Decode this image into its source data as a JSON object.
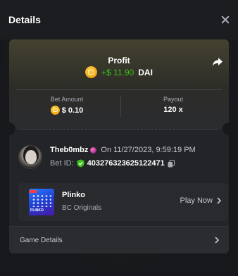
{
  "header": {
    "title": "Details"
  },
  "profit": {
    "label": "Profit",
    "amount": "+$ 11.90",
    "currency": "DAI"
  },
  "stats": {
    "bet_amount_label": "Bet Amount",
    "bet_amount_value": "$ 0.10",
    "payout_label": "Payout",
    "payout_value": "120 x"
  },
  "user": {
    "username": "Theb0mbz",
    "on_label": "On",
    "timestamp": "11/27/2023, 9:59:19 PM",
    "bet_id_label": "Bet ID:",
    "bet_id": "403276323625122471"
  },
  "game": {
    "name": "Plinko",
    "provider": "BC Originals",
    "play_label": "Play Now",
    "thumb_text": "PLINKO"
  },
  "game_details_label": "Game Details",
  "colors": {
    "profit_green": "#3bc117",
    "background": "#17181b",
    "card": "#232428",
    "coin_gold": "#f0a414"
  }
}
